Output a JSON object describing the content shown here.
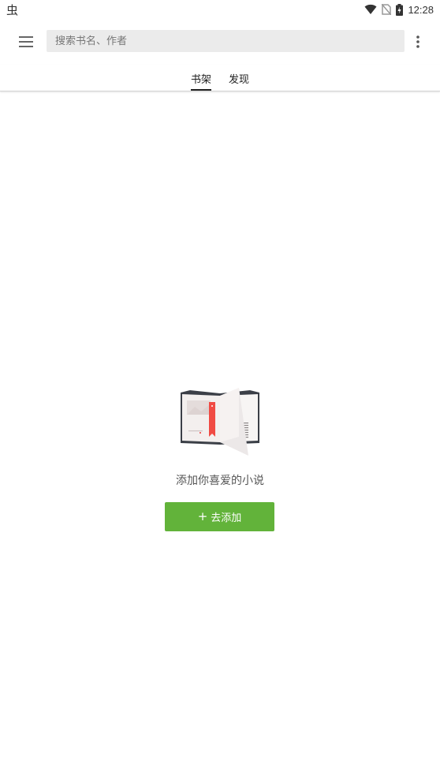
{
  "status_bar": {
    "app_glyph": "虫",
    "time": "12:28",
    "icons": [
      "wifi-icon",
      "no-sim-icon",
      "battery-charging-icon"
    ]
  },
  "toolbar": {
    "menu_icon": "hamburger-menu-icon",
    "search_placeholder": "搜索书名、作者",
    "search_value": "",
    "more_icon": "more-vertical-icon"
  },
  "tabs": [
    {
      "label": "书架",
      "active": true
    },
    {
      "label": "发现",
      "active": false
    }
  ],
  "empty_state": {
    "illustration": "open-book-illustration",
    "message": "添加你喜爱的小说",
    "button_icon": "+",
    "button_label": "去添加"
  },
  "colors": {
    "accent_green": "#62b33a",
    "search_bg": "#ebebeb",
    "bookmark_red": "#f04a43"
  }
}
